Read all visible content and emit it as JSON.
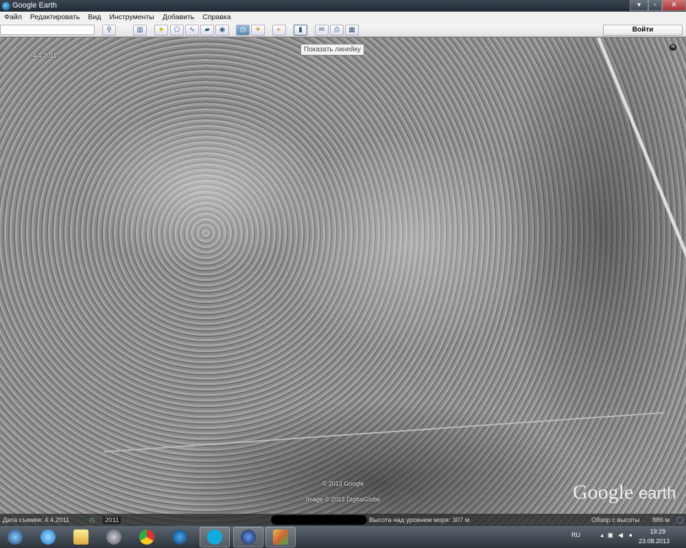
{
  "window": {
    "title": "Google Earth",
    "minimize": "▾",
    "restore": "▫",
    "close": "✕"
  },
  "menu": [
    "Файл",
    "Редактировать",
    "Вид",
    "Инструменты",
    "Добавить",
    "Справка"
  ],
  "toolbar": {
    "search_value": "",
    "login": "Войти",
    "tooltip": "Показать линейку"
  },
  "map": {
    "date_overlay": "4.4.2011",
    "copyright1": "© 2013 Google",
    "copyright2": "Image © 2013 DigitalGlobe",
    "logo_main": "Google",
    "logo_sub": "earth",
    "compass": "N"
  },
  "status": {
    "capture_date": "Дата съемки: 4.4.2011",
    "year": "2011",
    "elevation": "Высота над уровнем моря:  307 м",
    "eye_label": "Обзор с высоты",
    "eye_value": "886 м"
  },
  "tray": {
    "lang": "RU",
    "time": "19:29",
    "date": "23.08.2013"
  }
}
